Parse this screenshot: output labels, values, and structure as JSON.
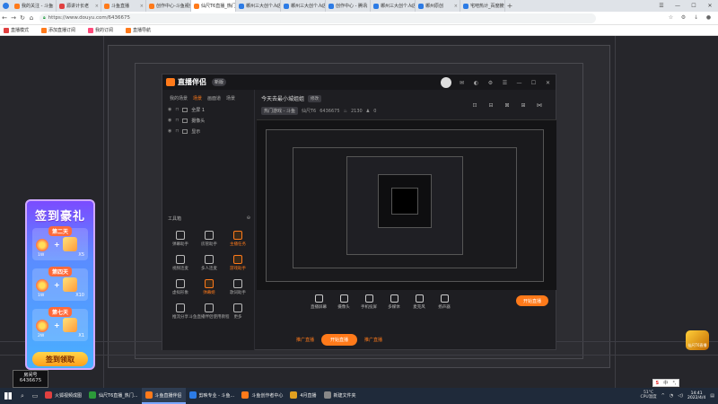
{
  "browser": {
    "tabs": [
      {
        "label": "我的关注 - 斗鱼",
        "color": "#ff7a1a",
        "active": false
      },
      {
        "label": "源讲计长老",
        "color": "#e04040",
        "active": false
      },
      {
        "label": "斗鱼直播",
        "color": "#ff7a1a",
        "active": false
      },
      {
        "label": "创作中心-斗鱼视频",
        "color": "#ff7a1a",
        "active": false
      },
      {
        "label": "仙尺T6直播_热门游戏",
        "color": "#ff7a1a",
        "active": true
      },
      {
        "label": "郴州三大创个人店",
        "color": "#2c7be5",
        "active": false
      },
      {
        "label": "郴州三大创个人店",
        "color": "#2c7be5",
        "active": false
      },
      {
        "label": "创作中心 - 腾讯",
        "color": "#2c7be5",
        "active": false
      },
      {
        "label": "郴州三大创个人店",
        "color": "#2c7be5",
        "active": false
      },
      {
        "label": "郴州原创",
        "color": "#2c7be5",
        "active": false
      },
      {
        "label": "宅吧热计_百度搜索",
        "color": "#2c7be5",
        "active": false
      }
    ],
    "new_tab": "+",
    "url": "https://www.douyu.com/6436675",
    "bookmarks": [
      {
        "label": "直播模式",
        "color": "#e04040"
      },
      {
        "label": "添加直播订阅",
        "color": "#ff7a1a"
      },
      {
        "label": "我的订阅",
        "color": "#ff4a7a"
      },
      {
        "label": "直播导航",
        "color": "#ff7a1a"
      }
    ]
  },
  "app": {
    "name": "直播伴侣",
    "version": "新版",
    "scene_tabs": [
      "我的场景",
      "场景",
      "画面道",
      "场景"
    ],
    "scenes": [
      "全屏 1",
      "摄像头",
      "显示"
    ],
    "toolbox_title": "工具箱",
    "tools": [
      {
        "label": "弹幕助手",
        "hot": false
      },
      {
        "label": "房管助手",
        "hot": false
      },
      {
        "label": "主播任务",
        "hot": true
      },
      {
        "label": "视频连麦",
        "hot": false
      },
      {
        "label": "多人连麦",
        "hot": false
      },
      {
        "label": "游戏助手",
        "hot": true
      },
      {
        "label": "虚拟形象",
        "hot": false
      },
      {
        "label": "弹幕姬",
        "hot": true
      },
      {
        "label": "歌词助手",
        "hot": false
      },
      {
        "label": "推流分享",
        "hot": false
      },
      {
        "label": "斗鱼直播伴侣使用教程",
        "hot": false
      },
      {
        "label": "更多",
        "hot": false
      }
    ],
    "room_title": "今天去最小城姐姐",
    "room_edit": "修改",
    "room_category": "热门游戏 - 斗鱼",
    "room_tag": "仙尺T6",
    "room_id": "6436675",
    "room_heat": "2130",
    "room_count": "0",
    "controls": [
      "直播屏幕",
      "摄像头",
      "手机投屏",
      "多媒体",
      "麦克风",
      "扬声器"
    ],
    "start_label": "开始直播"
  },
  "outer": {
    "left_link": "推广直播",
    "start_label": "开始直播",
    "right_link": "推广直播"
  },
  "promo": {
    "title": "签到豪礼",
    "days": [
      {
        "label": "第二天",
        "left": "1W",
        "right": "X5"
      },
      {
        "label": "第四天",
        "left": "1W",
        "right": "X10"
      },
      {
        "label": "第七天",
        "left": "2W",
        "right": "X1"
      }
    ],
    "button": "签到领取"
  },
  "room_badge": {
    "label": "房间号",
    "id": "6436675"
  },
  "emblem_text": "仙尺T6直播",
  "taskbar": {
    "apps": [
      {
        "label": "火狐视频成图",
        "color": "#e04040",
        "active": false
      },
      {
        "label": "仙尺T6直播_热门...",
        "color": "#2c9a3a",
        "active": false
      },
      {
        "label": "斗鱼直播伴侣",
        "color": "#ff7a1a",
        "active": true
      },
      {
        "label": "剪映专业 - 斗鱼...",
        "color": "#2c7be5",
        "active": false
      },
      {
        "label": "斗鱼创作者中心",
        "color": "#ff7a1a",
        "active": false
      },
      {
        "label": "4月直播",
        "color": "#e0a020",
        "active": false
      },
      {
        "label": "新建文件夹",
        "color": "#888888",
        "active": false
      }
    ],
    "weather": "51°C",
    "weather_label": "CPU温度",
    "time": "14:41",
    "date": "2022/4/4",
    "ime": "中"
  }
}
